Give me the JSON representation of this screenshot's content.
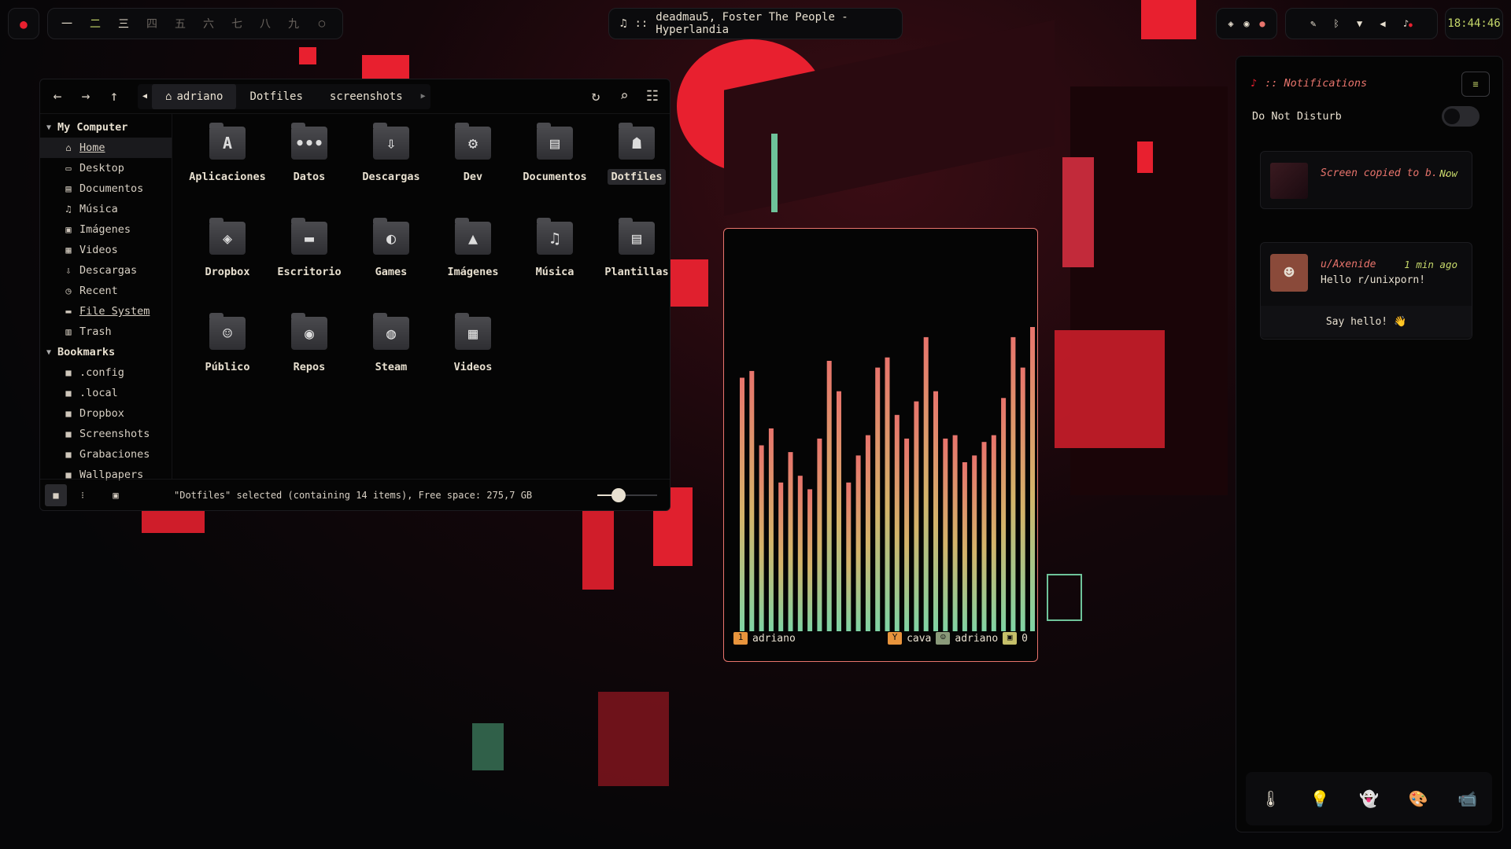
{
  "topbar": {
    "workspaces": [
      "一",
      "二",
      "三",
      "四",
      "五",
      "六",
      "七",
      "八",
      "九",
      "○"
    ],
    "media": {
      "icon": "music-note-icon",
      "separator": "::",
      "title": "deadmau5, Foster The People - Hyperlandia"
    },
    "tray_icons": [
      "dropbox-icon",
      "discord-icon",
      "chrome-icon"
    ],
    "status_icons": [
      "pen-icon",
      "bluetooth-icon",
      "wifi-icon",
      "volume-icon",
      "bell-icon"
    ],
    "clock": "18:44:46"
  },
  "file_manager": {
    "breadcrumbs": [
      "adriano",
      "Dotfiles",
      "screenshots"
    ],
    "sidebar": {
      "my_computer_label": "My Computer",
      "items": [
        {
          "label": "Home",
          "icon": "home-icon"
        },
        {
          "label": "Desktop",
          "icon": "desktop-icon"
        },
        {
          "label": "Documentos",
          "icon": "document-icon"
        },
        {
          "label": "Música",
          "icon": "music-icon"
        },
        {
          "label": "Imágenes",
          "icon": "image-icon"
        },
        {
          "label": "Videos",
          "icon": "film-icon"
        },
        {
          "label": "Descargas",
          "icon": "download-icon"
        },
        {
          "label": "Recent",
          "icon": "clock-icon"
        },
        {
          "label": "File System",
          "icon": "drive-icon"
        },
        {
          "label": "Trash",
          "icon": "trash-icon"
        }
      ],
      "bookmarks_label": "Bookmarks",
      "bookmarks": [
        ".config",
        ".local",
        "Dropbox",
        "Screenshots",
        "Grabaciones",
        "Wallpapers"
      ]
    },
    "files": [
      {
        "name": "Aplicaciones",
        "glyph": "A"
      },
      {
        "name": "Datos",
        "glyph": "•••"
      },
      {
        "name": "Descargas",
        "glyph": "⇩"
      },
      {
        "name": "Dev",
        "glyph": "⚙"
      },
      {
        "name": "Documentos",
        "glyph": "▤"
      },
      {
        "name": "Dotfiles",
        "glyph": "☗"
      },
      {
        "name": "Dropbox",
        "glyph": "◈"
      },
      {
        "name": "Escritorio",
        "glyph": "▬"
      },
      {
        "name": "Games",
        "glyph": "◐"
      },
      {
        "name": "Imágenes",
        "glyph": "▲"
      },
      {
        "name": "Música",
        "glyph": "♫"
      },
      {
        "name": "Plantillas",
        "glyph": "▤"
      },
      {
        "name": "Público",
        "glyph": "☺"
      },
      {
        "name": "Repos",
        "glyph": "◉"
      },
      {
        "name": "Steam",
        "glyph": "◍"
      },
      {
        "name": "Videos",
        "glyph": "▦"
      }
    ],
    "selected_file": "Dotfiles",
    "status_text": "\"Dotfiles\" selected (containing 14 items), Free space: 275,7 GB",
    "zoom_level": 0.35
  },
  "cava": {
    "bars": [
      0.75,
      0.77,
      0.55,
      0.6,
      0.44,
      0.53,
      0.46,
      0.42,
      0.57,
      0.8,
      0.71,
      0.44,
      0.52,
      0.58,
      0.78,
      0.81,
      0.64,
      0.57,
      0.68,
      0.87,
      0.71,
      0.57,
      0.58,
      0.5,
      0.52,
      0.56,
      0.58,
      0.69,
      0.87,
      0.78,
      0.9
    ],
    "colors": {
      "top": "#e8746c",
      "mid": "#d4b46a",
      "bottom": "#7fd3a4"
    },
    "status": {
      "left_index": "1",
      "user": "adriano",
      "app": "cava",
      "right_user": "adriano",
      "count": "0"
    }
  },
  "notifications": {
    "header": ":: Notifications",
    "dnd_label": "Do Not Disturb",
    "items": [
      {
        "title": "Screen copied to b...",
        "time": "Now"
      },
      {
        "title": "u/Axenide",
        "time": "1 min ago",
        "body": "Hello r/unixporn!",
        "action": "Say hello! 👋"
      }
    ],
    "dock_icons": [
      "thermometer-icon",
      "bulb-icon",
      "ghost-icon",
      "palette-icon",
      "camera-icon"
    ]
  },
  "colors": {
    "accent": "#e8746c",
    "clock": "#c6d86a",
    "bg": "#050505"
  }
}
